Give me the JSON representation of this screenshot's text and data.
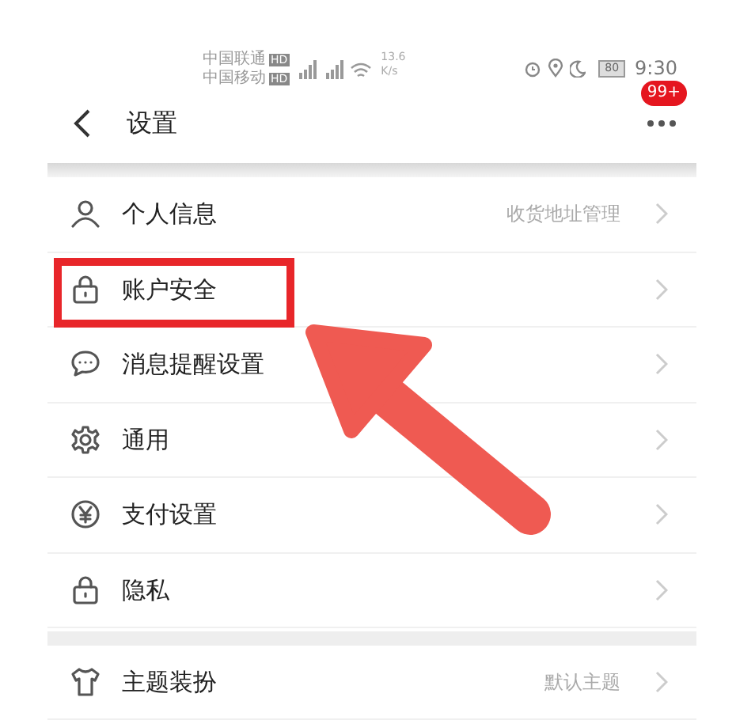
{
  "status_bar": {
    "carriers": [
      {
        "name": "中国联通",
        "badge": "HD"
      },
      {
        "name": "中国移动",
        "badge": "HD"
      }
    ],
    "speed": "13.6",
    "speed_unit": "K/s",
    "battery": "80",
    "time": "9:30"
  },
  "header": {
    "title": "设置",
    "badge": "99+"
  },
  "groups": [
    {
      "rows": [
        {
          "label": "个人信息",
          "value": "收货地址管理",
          "highlighted": false
        },
        {
          "label": "账户安全",
          "highlighted": true
        },
        {
          "label": "消息提醒设置",
          "highlighted": false
        },
        {
          "label": "通用",
          "highlighted": false
        },
        {
          "label": "支付设置",
          "highlighted": false
        },
        {
          "label": "隐私",
          "highlighted": false
        }
      ]
    },
    {
      "rows": [
        {
          "label": "主题装扮",
          "value": "默认主题",
          "highlighted": false
        }
      ]
    }
  ]
}
